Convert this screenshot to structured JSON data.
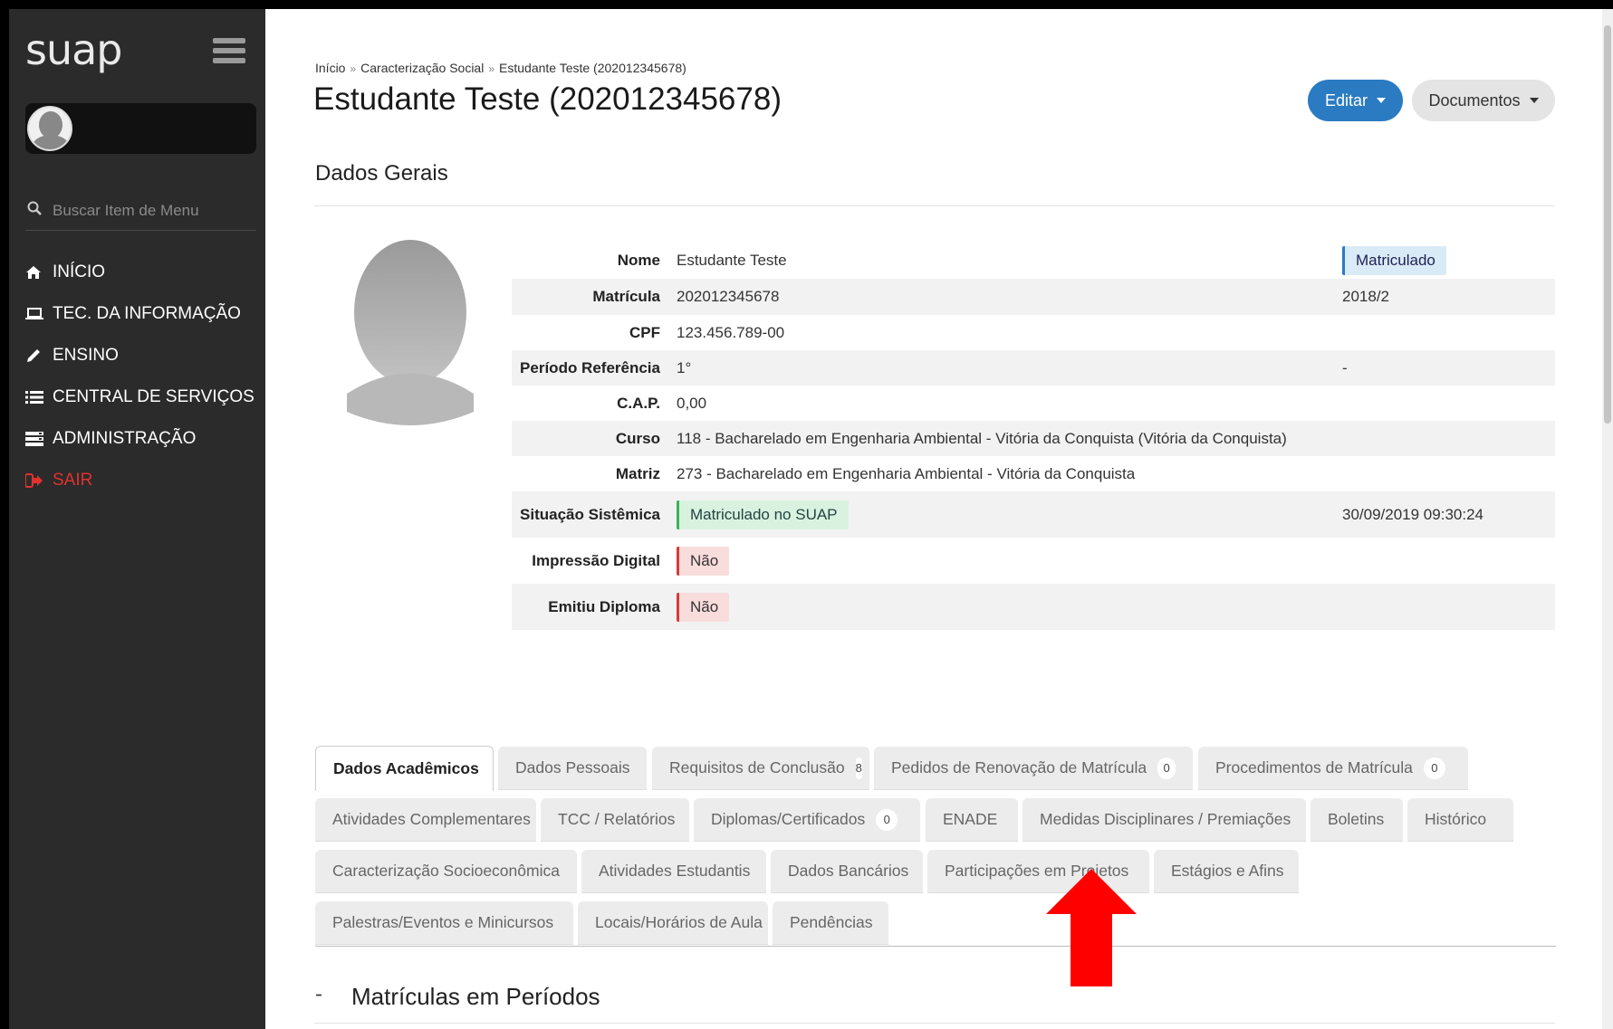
{
  "sidebar": {
    "logo": "suap",
    "search_placeholder": "Buscar Item de Menu",
    "items": [
      {
        "label": "INÍCIO"
      },
      {
        "label": "TEC. DA INFORMAÇÃO"
      },
      {
        "label": "ENSINO"
      },
      {
        "label": "CENTRAL DE SERVIÇOS"
      },
      {
        "label": "ADMINISTRAÇÃO"
      },
      {
        "label": "SAIR"
      }
    ]
  },
  "breadcrumb": [
    "Início",
    "Caracterização Social",
    "Estudante Teste (202012345678)"
  ],
  "page_title": "Estudante Teste (202012345678)",
  "actions": {
    "edit": "Editar",
    "docs": "Documentos"
  },
  "section_title": "Dados Gerais",
  "info": {
    "nome_label": "Nome",
    "nome": "Estudante Teste",
    "status": "Matriculado",
    "matricula_label": "Matrícula",
    "matricula": "202012345678",
    "periodo": "2018/2",
    "cpf_label": "CPF",
    "cpf": "123.456.789-00",
    "periodo_ref_label": "Período Referência",
    "periodo_ref": "1°",
    "periodo_ref_extra": "-",
    "cap_label": "C.A.P.",
    "cap": "0,00",
    "curso_label": "Curso",
    "curso": "118 - Bacharelado em Engenharia Ambiental - Vitória da Conquista (Vitória da Conquista)",
    "matriz_label": "Matriz",
    "matriz": "273 - Bacharelado em Engenharia Ambiental - Vitória da Conquista",
    "situacao_label": "Situação Sistêmica",
    "situacao": "Matriculado no SUAP",
    "situacao_data": "30/09/2019 09:30:24",
    "impressao_label": "Impressão Digital",
    "impressao": "Não",
    "diploma_label": "Emitiu Diploma",
    "diploma": "Não"
  },
  "tabs": {
    "row1": [
      {
        "label": "Dados Acadêmicos"
      },
      {
        "label": "Dados Pessoais"
      },
      {
        "label": "Requisitos de Conclusão",
        "count": "8"
      },
      {
        "label": "Pedidos de Renovação de Matrícula",
        "count": "0"
      },
      {
        "label": "Procedimentos de Matrícula",
        "count": "0"
      }
    ],
    "row2": [
      {
        "label": "Atividades Complementares"
      },
      {
        "label": "TCC / Relatórios"
      },
      {
        "label": "Diplomas/Certificados",
        "count": "0"
      },
      {
        "label": "ENADE"
      },
      {
        "label": "Medidas Disciplinares / Premiações"
      },
      {
        "label": "Boletins"
      },
      {
        "label": "Histórico"
      }
    ],
    "row3": [
      {
        "label": "Caracterização Socioeconômica"
      },
      {
        "label": "Atividades Estudantis"
      },
      {
        "label": "Dados Bancários"
      },
      {
        "label": "Participações em Projetos"
      },
      {
        "label": "Estágios e Afins"
      }
    ],
    "row4": [
      {
        "label": "Palestras/Eventos e Minicursos"
      },
      {
        "label": "Locais/Horários de Aula"
      },
      {
        "label": "Pendências"
      }
    ]
  },
  "subsection": {
    "dash": "-",
    "title": "Matrículas em Períodos"
  },
  "colors": {
    "sidebar_bg": "#2b2b2b",
    "primary": "#2b7bc2",
    "danger": "#e0322e",
    "arrow": "#ff0000"
  }
}
